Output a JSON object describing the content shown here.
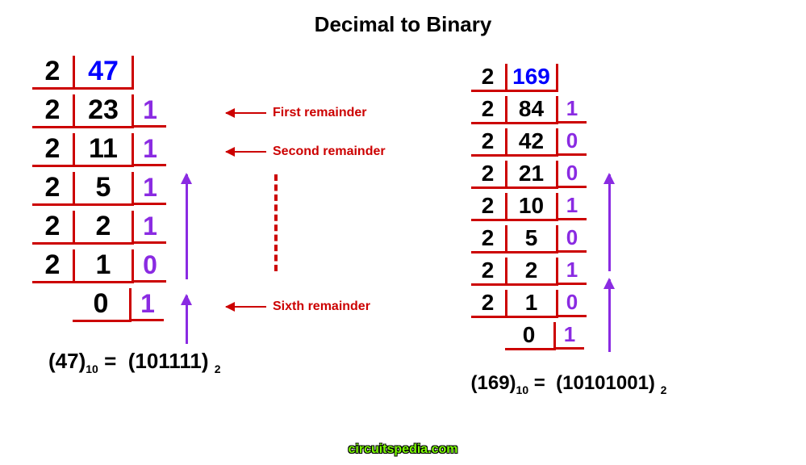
{
  "title": "Decimal to Binary",
  "left": {
    "input": "47",
    "rows": [
      {
        "d": "2",
        "q": "47",
        "r": ""
      },
      {
        "d": "2",
        "q": "23",
        "r": "1"
      },
      {
        "d": "2",
        "q": "11",
        "r": "1"
      },
      {
        "d": "2",
        "q": "5",
        "r": "1"
      },
      {
        "d": "2",
        "q": "2",
        "r": "1"
      },
      {
        "d": "2",
        "q": "1",
        "r": "0"
      },
      {
        "d": "",
        "q": "0",
        "r": "1"
      }
    ],
    "anno1": "First remainder",
    "anno2": "Second remainder",
    "anno3": "Sixth remainder",
    "result_dec": "(47)",
    "result_bin": "(101111)",
    "base10": "10",
    "base2": "2",
    "equals": "="
  },
  "right": {
    "input": "169",
    "rows": [
      {
        "d": "2",
        "q": "169",
        "r": ""
      },
      {
        "d": "2",
        "q": "84",
        "r": "1"
      },
      {
        "d": "2",
        "q": "42",
        "r": "0"
      },
      {
        "d": "2",
        "q": "21",
        "r": "0"
      },
      {
        "d": "2",
        "q": "10",
        "r": "1"
      },
      {
        "d": "2",
        "q": "5",
        "r": "0"
      },
      {
        "d": "2",
        "q": "2",
        "r": "1"
      },
      {
        "d": "2",
        "q": "1",
        "r": "0"
      },
      {
        "d": "",
        "q": "0",
        "r": "1"
      }
    ],
    "result_dec": "(169)",
    "result_bin": "(10101001)",
    "base10": "10",
    "base2": "2",
    "equals": "="
  },
  "watermark": "circuitspedia.com",
  "chart_data": [
    {
      "type": "table",
      "title": "Division by 2 — 47",
      "divisor": [
        2,
        2,
        2,
        2,
        2,
        2
      ],
      "quotient": [
        47,
        23,
        11,
        5,
        2,
        1,
        0
      ],
      "remainder": [
        1,
        1,
        1,
        1,
        0,
        1
      ],
      "binary_result": "101111",
      "decimal_input": 47
    },
    {
      "type": "table",
      "title": "Division by 2 — 169",
      "divisor": [
        2,
        2,
        2,
        2,
        2,
        2,
        2,
        2
      ],
      "quotient": [
        169,
        84,
        42,
        21,
        10,
        5,
        2,
        1,
        0
      ],
      "remainder": [
        1,
        0,
        0,
        1,
        0,
        1,
        0,
        1
      ],
      "binary_result": "10101001",
      "decimal_input": 169
    }
  ]
}
